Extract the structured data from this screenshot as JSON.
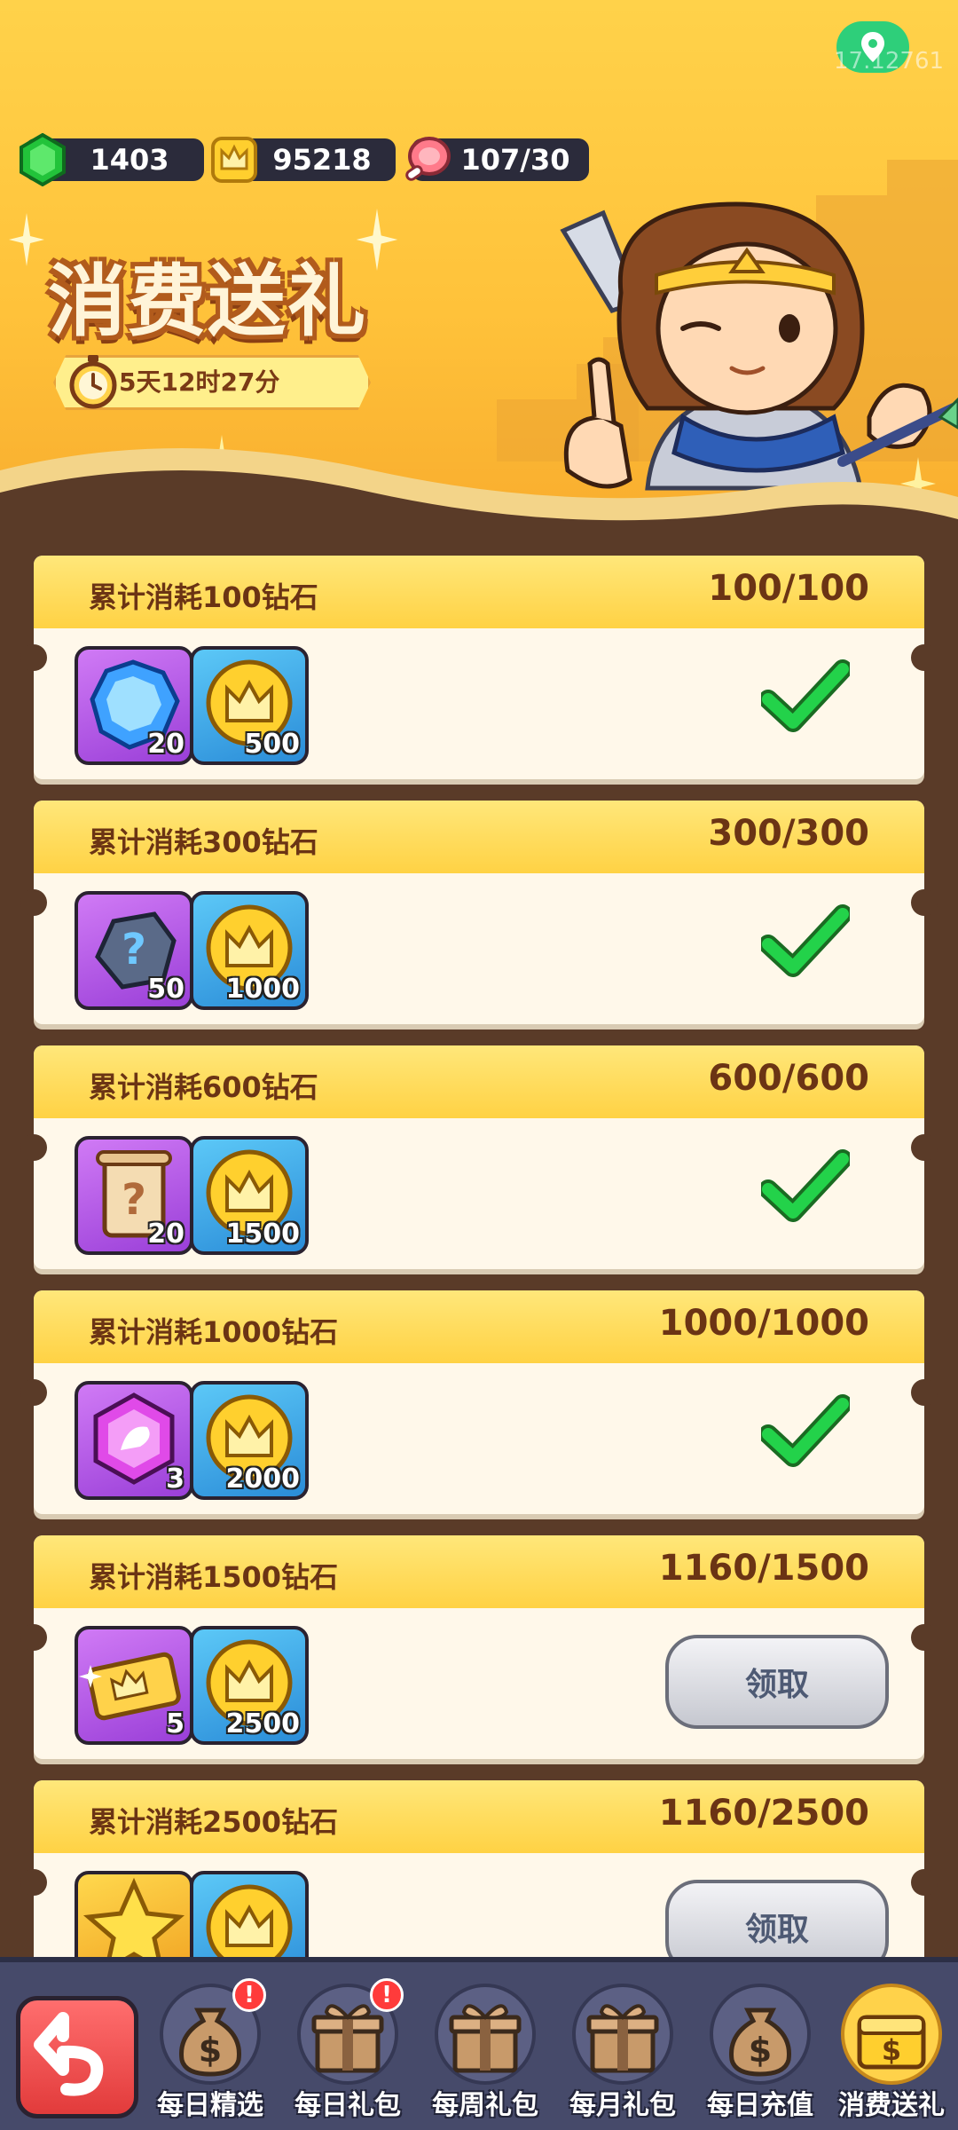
{
  "status": {
    "location_id": "17.12761"
  },
  "resources": {
    "gems": "1403",
    "coins": "95218",
    "stamina": "107/30"
  },
  "event": {
    "title": "消费送礼",
    "countdown": "5天12时27分"
  },
  "tiers": [
    {
      "title": "累计消耗100钻石",
      "progress": "100/100",
      "rewards": [
        {
          "icon": "blue-gem-icon",
          "qty": "20"
        },
        {
          "icon": "crown-coin-icon",
          "qty": "500"
        }
      ],
      "status": "claimed"
    },
    {
      "title": "累计消耗300钻石",
      "progress": "300/300",
      "rewards": [
        {
          "icon": "mystery-ore-icon",
          "qty": "50"
        },
        {
          "icon": "crown-coin-icon",
          "qty": "1000"
        }
      ],
      "status": "claimed"
    },
    {
      "title": "累计消耗600钻石",
      "progress": "600/600",
      "rewards": [
        {
          "icon": "mystery-scroll-icon",
          "qty": "20"
        },
        {
          "icon": "crown-coin-icon",
          "qty": "1500"
        }
      ],
      "status": "claimed"
    },
    {
      "title": "累计消耗1000钻石",
      "progress": "1000/1000",
      "rewards": [
        {
          "icon": "pink-rune-gem-icon",
          "qty": "3"
        },
        {
          "icon": "crown-coin-icon",
          "qty": "2000"
        }
      ],
      "status": "claimed"
    },
    {
      "title": "累计消耗1500钻石",
      "progress": "1160/1500",
      "rewards": [
        {
          "icon": "gold-ticket-icon",
          "qty": "5"
        },
        {
          "icon": "crown-coin-icon",
          "qty": "2500"
        }
      ],
      "status": "claim",
      "button_label": "领取"
    },
    {
      "title": "累计消耗2500钻石",
      "progress": "1160/2500",
      "rewards": [
        {
          "icon": "gold-star-icon",
          "qty": ""
        },
        {
          "icon": "crown-coin-icon",
          "qty": ""
        }
      ],
      "status": "claim",
      "button_label": "领取"
    }
  ],
  "nav": {
    "items": [
      {
        "label": "每日精选",
        "icon": "money-bag-icon",
        "badge": "!"
      },
      {
        "label": "每日礼包",
        "icon": "gift-box-icon",
        "badge": "!"
      },
      {
        "label": "每周礼包",
        "icon": "gift-box-icon",
        "badge": ""
      },
      {
        "label": "每月礼包",
        "icon": "gift-box-icon",
        "badge": ""
      },
      {
        "label": "每日充值",
        "icon": "money-bag-icon",
        "badge": ""
      },
      {
        "label": "消费送礼",
        "icon": "coin-chest-icon",
        "badge": "",
        "active": true
      }
    ]
  },
  "colors": {
    "accent": "#ffd24a",
    "header_band": "#ffd244",
    "check_green": "#23d24a",
    "nav_bg": "#464a6a"
  }
}
